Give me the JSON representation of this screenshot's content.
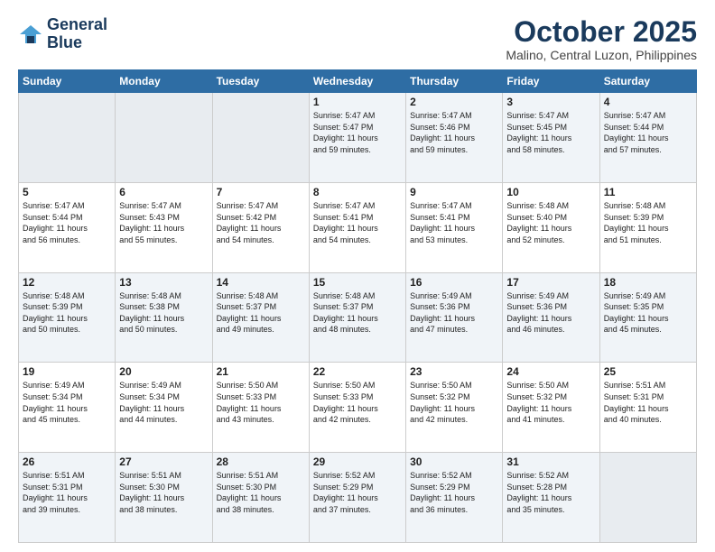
{
  "logo": {
    "line1": "General",
    "line2": "Blue"
  },
  "header": {
    "month": "October 2025",
    "location": "Malino, Central Luzon, Philippines"
  },
  "weekdays": [
    "Sunday",
    "Monday",
    "Tuesday",
    "Wednesday",
    "Thursday",
    "Friday",
    "Saturday"
  ],
  "weeks": [
    [
      {
        "day": "",
        "info": ""
      },
      {
        "day": "",
        "info": ""
      },
      {
        "day": "",
        "info": ""
      },
      {
        "day": "1",
        "info": "Sunrise: 5:47 AM\nSunset: 5:47 PM\nDaylight: 11 hours\nand 59 minutes."
      },
      {
        "day": "2",
        "info": "Sunrise: 5:47 AM\nSunset: 5:46 PM\nDaylight: 11 hours\nand 59 minutes."
      },
      {
        "day": "3",
        "info": "Sunrise: 5:47 AM\nSunset: 5:45 PM\nDaylight: 11 hours\nand 58 minutes."
      },
      {
        "day": "4",
        "info": "Sunrise: 5:47 AM\nSunset: 5:44 PM\nDaylight: 11 hours\nand 57 minutes."
      }
    ],
    [
      {
        "day": "5",
        "info": "Sunrise: 5:47 AM\nSunset: 5:44 PM\nDaylight: 11 hours\nand 56 minutes."
      },
      {
        "day": "6",
        "info": "Sunrise: 5:47 AM\nSunset: 5:43 PM\nDaylight: 11 hours\nand 55 minutes."
      },
      {
        "day": "7",
        "info": "Sunrise: 5:47 AM\nSunset: 5:42 PM\nDaylight: 11 hours\nand 54 minutes."
      },
      {
        "day": "8",
        "info": "Sunrise: 5:47 AM\nSunset: 5:41 PM\nDaylight: 11 hours\nand 54 minutes."
      },
      {
        "day": "9",
        "info": "Sunrise: 5:47 AM\nSunset: 5:41 PM\nDaylight: 11 hours\nand 53 minutes."
      },
      {
        "day": "10",
        "info": "Sunrise: 5:48 AM\nSunset: 5:40 PM\nDaylight: 11 hours\nand 52 minutes."
      },
      {
        "day": "11",
        "info": "Sunrise: 5:48 AM\nSunset: 5:39 PM\nDaylight: 11 hours\nand 51 minutes."
      }
    ],
    [
      {
        "day": "12",
        "info": "Sunrise: 5:48 AM\nSunset: 5:39 PM\nDaylight: 11 hours\nand 50 minutes."
      },
      {
        "day": "13",
        "info": "Sunrise: 5:48 AM\nSunset: 5:38 PM\nDaylight: 11 hours\nand 50 minutes."
      },
      {
        "day": "14",
        "info": "Sunrise: 5:48 AM\nSunset: 5:37 PM\nDaylight: 11 hours\nand 49 minutes."
      },
      {
        "day": "15",
        "info": "Sunrise: 5:48 AM\nSunset: 5:37 PM\nDaylight: 11 hours\nand 48 minutes."
      },
      {
        "day": "16",
        "info": "Sunrise: 5:49 AM\nSunset: 5:36 PM\nDaylight: 11 hours\nand 47 minutes."
      },
      {
        "day": "17",
        "info": "Sunrise: 5:49 AM\nSunset: 5:36 PM\nDaylight: 11 hours\nand 46 minutes."
      },
      {
        "day": "18",
        "info": "Sunrise: 5:49 AM\nSunset: 5:35 PM\nDaylight: 11 hours\nand 45 minutes."
      }
    ],
    [
      {
        "day": "19",
        "info": "Sunrise: 5:49 AM\nSunset: 5:34 PM\nDaylight: 11 hours\nand 45 minutes."
      },
      {
        "day": "20",
        "info": "Sunrise: 5:49 AM\nSunset: 5:34 PM\nDaylight: 11 hours\nand 44 minutes."
      },
      {
        "day": "21",
        "info": "Sunrise: 5:50 AM\nSunset: 5:33 PM\nDaylight: 11 hours\nand 43 minutes."
      },
      {
        "day": "22",
        "info": "Sunrise: 5:50 AM\nSunset: 5:33 PM\nDaylight: 11 hours\nand 42 minutes."
      },
      {
        "day": "23",
        "info": "Sunrise: 5:50 AM\nSunset: 5:32 PM\nDaylight: 11 hours\nand 42 minutes."
      },
      {
        "day": "24",
        "info": "Sunrise: 5:50 AM\nSunset: 5:32 PM\nDaylight: 11 hours\nand 41 minutes."
      },
      {
        "day": "25",
        "info": "Sunrise: 5:51 AM\nSunset: 5:31 PM\nDaylight: 11 hours\nand 40 minutes."
      }
    ],
    [
      {
        "day": "26",
        "info": "Sunrise: 5:51 AM\nSunset: 5:31 PM\nDaylight: 11 hours\nand 39 minutes."
      },
      {
        "day": "27",
        "info": "Sunrise: 5:51 AM\nSunset: 5:30 PM\nDaylight: 11 hours\nand 38 minutes."
      },
      {
        "day": "28",
        "info": "Sunrise: 5:51 AM\nSunset: 5:30 PM\nDaylight: 11 hours\nand 38 minutes."
      },
      {
        "day": "29",
        "info": "Sunrise: 5:52 AM\nSunset: 5:29 PM\nDaylight: 11 hours\nand 37 minutes."
      },
      {
        "day": "30",
        "info": "Sunrise: 5:52 AM\nSunset: 5:29 PM\nDaylight: 11 hours\nand 36 minutes."
      },
      {
        "day": "31",
        "info": "Sunrise: 5:52 AM\nSunset: 5:28 PM\nDaylight: 11 hours\nand 35 minutes."
      },
      {
        "day": "",
        "info": ""
      }
    ]
  ]
}
